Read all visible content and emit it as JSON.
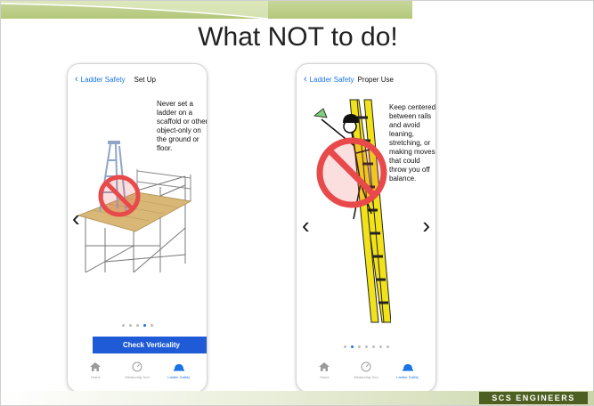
{
  "slide": {
    "title": "What NOT to do!",
    "brand": "SCS ENGINEERS"
  },
  "phones": [
    {
      "back_label": "Ladder Safety",
      "screen_title": "Set Up",
      "instruction": "Never set a ladder on a scaffold or other object-only on the ground or floor.",
      "button_label": "Check Verticality",
      "dots_total": 5,
      "active_dot": 4,
      "tabs": [
        "Home",
        "Measuring Tool",
        "Ladder Safety"
      ],
      "active_tab": 2
    },
    {
      "back_label": "Ladder Safety",
      "screen_title": "Proper Use",
      "instruction": "Keep centered between rails and avoid leaning, stretching, or making moves that could throw you off balance.",
      "dots_total": 7,
      "active_dot": 1,
      "tabs": [
        "Home",
        "Measuring Tool",
        "Ladder Safety"
      ],
      "active_tab": 2
    }
  ],
  "icons": {
    "back": "chevron-left-icon",
    "prev": "chevron-left-icon",
    "next": "chevron-right-icon",
    "home": "home-icon",
    "measure": "gauge-icon",
    "safety": "hard-hat-icon",
    "prohibited": "prohibition-icon"
  },
  "colors": {
    "accent": "#1a73e8",
    "button": "#1f5bd6",
    "prohibition": "#e8494a",
    "ladder_yellow": "#f2e21a",
    "stepladder_blue": "#8fa6c9",
    "platform_wood": "#d9b877",
    "brand_green": "#4e5f22",
    "header_green": "#b4c87a"
  }
}
